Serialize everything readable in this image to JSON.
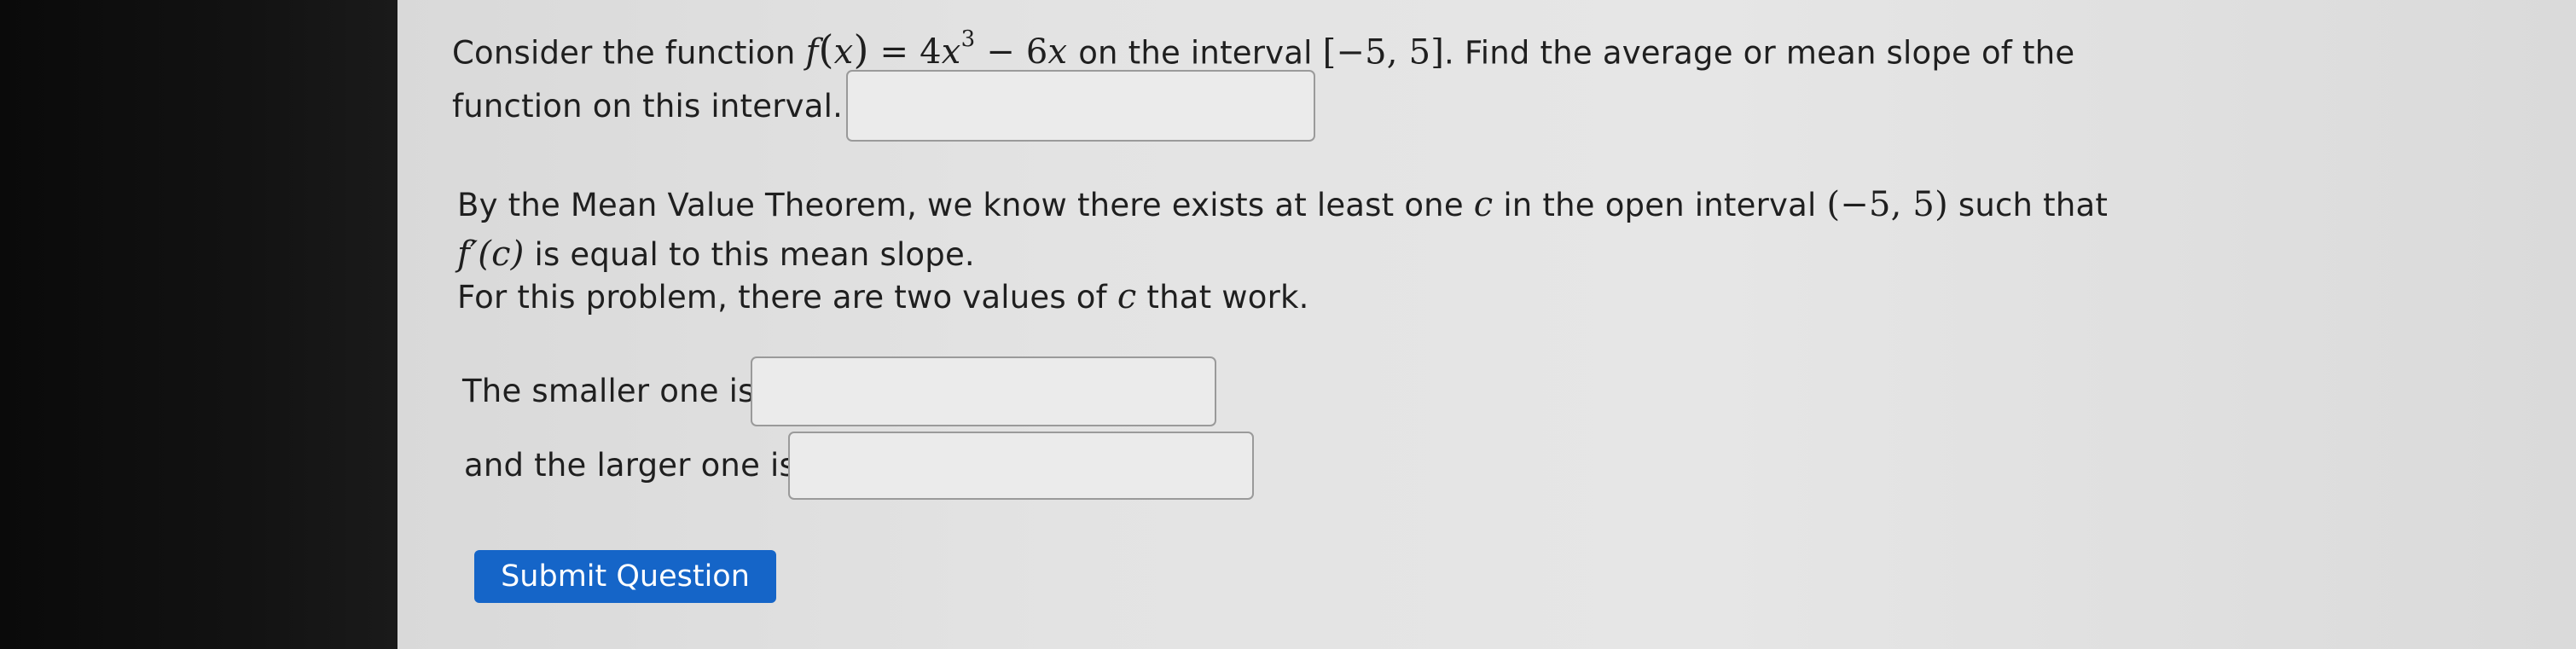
{
  "question": {
    "intro_text": "Consider the function",
    "function_f": "f",
    "function_x": "x",
    "function_rhs_a": "= 4",
    "function_rhs_x": "x",
    "function_rhs_exp": "3",
    "function_rhs_b": "− 6",
    "function_rhs_x2": "x",
    "interval_prefix": "on the interval",
    "interval": "[−5, 5]",
    "find_text": ". Find the average or mean slope of the",
    "line2_text": "function on this interval.",
    "mvt_line1_a": "By the Mean Value Theorem, we know there exists at least one",
    "mvt_c": "c",
    "mvt_line1_b": "in the open interval",
    "open_interval": "(−5, 5)",
    "mvt_line1_c": "such that",
    "mvt_fprime": "f′(c)",
    "mvt_line2_rest": "is equal to this mean slope.",
    "mvt_line3_a": "For this problem, there are two values of",
    "mvt_line3_c": "c",
    "mvt_line3_b": "that work.",
    "smaller_label": "The smaller one is",
    "larger_label": "and the larger one is"
  },
  "inputs": {
    "mean_slope_value": "",
    "smaller_value": "",
    "larger_value": ""
  },
  "buttons": {
    "submit_label": "Submit Question"
  },
  "colors": {
    "submit_bg": "#1565c8",
    "page_bg": "#e3e3e3"
  }
}
